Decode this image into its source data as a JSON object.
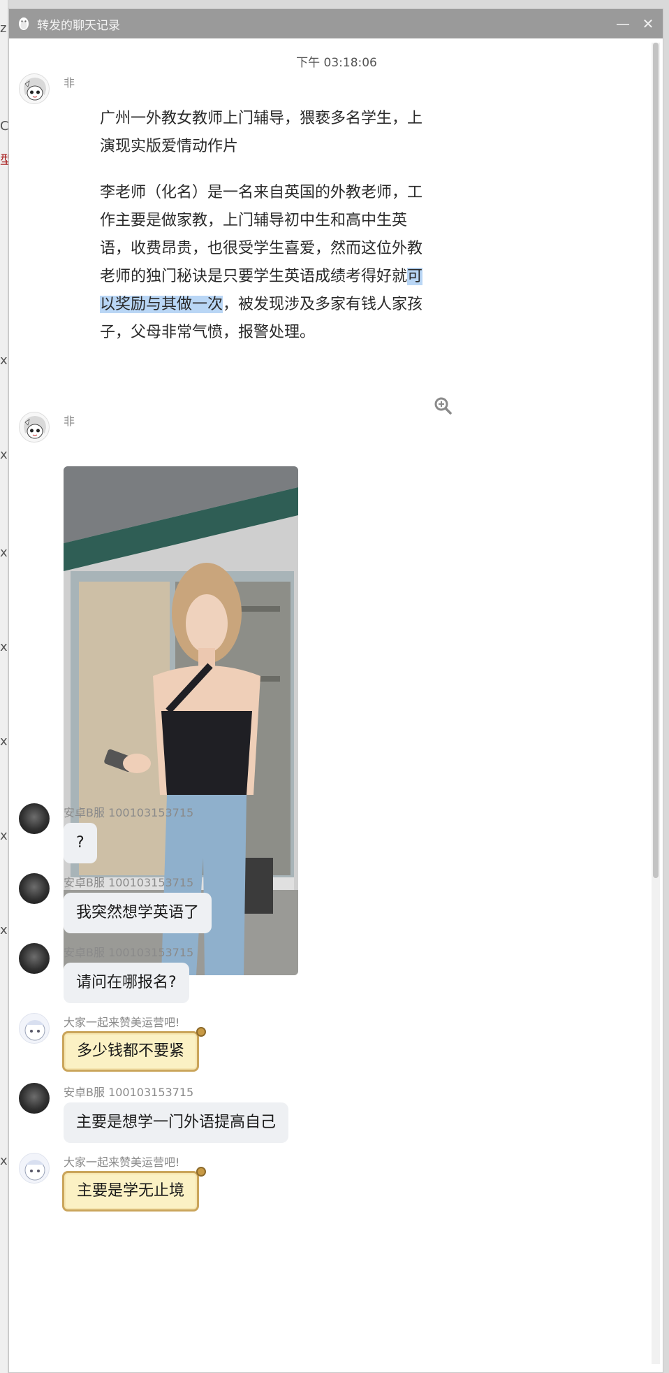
{
  "window": {
    "title": "转发的聊天记录",
    "minimize_glyph": "—",
    "close_glyph": "✕"
  },
  "chat": {
    "timestamp": "下午 03:18:06",
    "messages": [
      {
        "sender": "非",
        "avatar": "anime-avatar",
        "type": "article",
        "paragraph1": "广州一外教女教师上门辅导，猥亵多名学生，上演现实版爱情动作片",
        "paragraph2_before": "李老师（化名）是一名来自英国的外教老师，工作主要是做家教，上门辅导初中生和高中生英语，收费昂贵，也很受学生喜爱，然而这位外教老师的独门秘诀是只要学生英语成绩考得好就",
        "paragraph2_highlight": "可以奖励与其做一次",
        "paragraph2_after": "，被发现涉及多家有钱人家孩子，父母非常气愤，报警处理。"
      },
      {
        "sender": "非",
        "avatar": "anime-avatar",
        "type": "image",
        "image": "photo-woman-storefront"
      },
      {
        "sender": "安卓B服 100103153715",
        "avatar": "dark-avatar",
        "text": "?"
      },
      {
        "sender": "安卓B服 100103153715",
        "avatar": "dark-avatar",
        "text": "我突然想学英语了"
      },
      {
        "sender": "安卓B服 100103153715",
        "avatar": "dark-avatar",
        "text": "请问在哪报名?"
      },
      {
        "sender": "大家一起来赞美运营吧!",
        "avatar": "cute-avatar",
        "text": "多少钱都不要紧",
        "style": "scroll"
      },
      {
        "sender": "安卓B服 100103153715",
        "avatar": "dark-avatar",
        "text": "主要是想学一门外语提高自己"
      },
      {
        "sender": "大家一起来赞美运营吧!",
        "avatar": "cute-avatar",
        "text": "主要是学无止境",
        "style": "scroll"
      }
    ]
  },
  "left_strip_chars": [
    "z",
    "C",
    "型",
    "x",
    "ㄨ",
    "x",
    "x",
    "x",
    "x",
    "x",
    "x",
    "x"
  ],
  "colors": {
    "titlebar": "#9a9a9a",
    "bubble": "#eef0f3",
    "scroll_bubble": "#fbf1c4",
    "highlight": "#b9d6f5"
  }
}
